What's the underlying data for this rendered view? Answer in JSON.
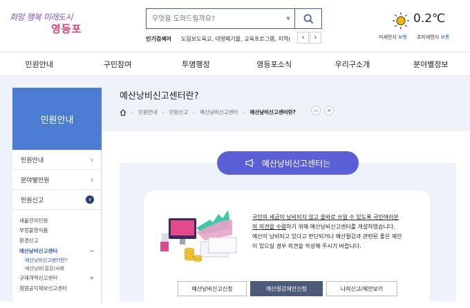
{
  "header": {
    "logo_slogan": "희망 행복 미래도시",
    "logo_city": "영등포",
    "search_placeholder": "무엇을 도와드릴까요?",
    "popular_label": "인기검색어",
    "popular_terms": "도림보도육교, 대형폐기물, 교육프로그램, 지역(",
    "weather_temp": "0.2℃",
    "fine_dust_label": "미세먼지",
    "fine_dust_value": "보통",
    "ultra_dust_label": "초미세먼지",
    "ultra_dust_value": "보통"
  },
  "gnb": [
    "민원안내",
    "구민참여",
    "투명행정",
    "영등포소식",
    "우리구소개",
    "분야별정보"
  ],
  "lnb": {
    "title": "민원안내",
    "items": [
      "민원안내",
      "분야별민원",
      "민원신고"
    ],
    "sub": [
      "새올전자민원",
      "부정불량식품",
      "환경신고",
      "예산낭비신고센터",
      "규제개혁신고센터",
      "청렴공익제보신고센터"
    ],
    "subsub": [
      "예산낭비신고센터란?",
      "예산낭비(절감)사례"
    ]
  },
  "page": {
    "title": "예산낭비신고센터란?",
    "breadcrumb": [
      "민원안내",
      "민원신고",
      "예산낭비신고센터",
      "예산낭비신고센터란?"
    ]
  },
  "content": {
    "banner": "예산낭비신고센터는",
    "desc_l1_ul": "국민의 세금이 낭비되지 않고 올바로 쓰일 수 있도록 국민여러분",
    "desc_l2_ul": "의 의견을 수렴",
    "desc_l2_rest": "하기 위해 예산낭비신고센터를 개설하였습니다.",
    "desc_l3": "예산이 낭비되고 있다고 판단되거나 예산절감과 관련된 좋은 제안",
    "desc_l4": "이 있으실 경우 의견을 작성해 주시기 바랍니다.",
    "buttons": [
      "예산낭비신고신청",
      "예산절감제안신청",
      "나의신고/제안보기"
    ]
  },
  "colors": {
    "primary": "#4a7dd3",
    "banner": "#5a5fd6",
    "active_btn": "#4c5a7a"
  }
}
